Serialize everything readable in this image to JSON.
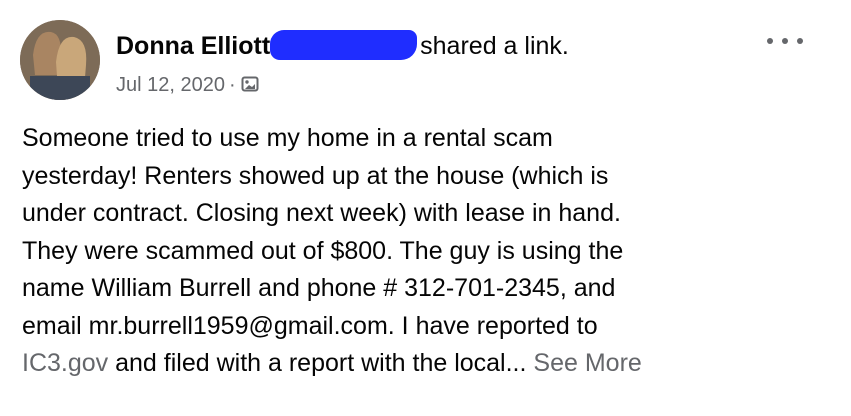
{
  "post": {
    "author_name": "Donna Elliott",
    "action_text": "shared a link.",
    "date": "Jul 12, 2020",
    "separator": "·",
    "audience_icon": "photo-album-icon",
    "more_icon": "more-options-icon",
    "body": [
      "Someone tried to use my home in a rental scam",
      "yesterday!  Renters showed up at the house (which is",
      "under contract. Closing next week) with lease in hand.",
      "They were scammed out of $800.   The guy is using the",
      "name William Burrell and phone # 312-701-2345, and",
      "email mr.burrell1959@gmail.com.  I have reported to"
    ],
    "last_line_link": "IC3.gov",
    "last_line_text": " and filed with a report with the local...",
    "see_more_label": "See More"
  },
  "colors": {
    "text": "#050505",
    "secondary": "#65676b",
    "redaction": "#1f2dff"
  }
}
